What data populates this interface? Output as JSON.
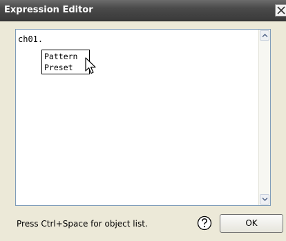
{
  "window": {
    "title": "Expression Editor",
    "close_icon": "close-icon"
  },
  "editor": {
    "text": "ch01."
  },
  "autocomplete": {
    "items": [
      "Pattern",
      "Preset"
    ]
  },
  "footer": {
    "status_text": "Press Ctrl+Space for object list.",
    "help_icon": "help-icon",
    "ok_label": "OK"
  }
}
